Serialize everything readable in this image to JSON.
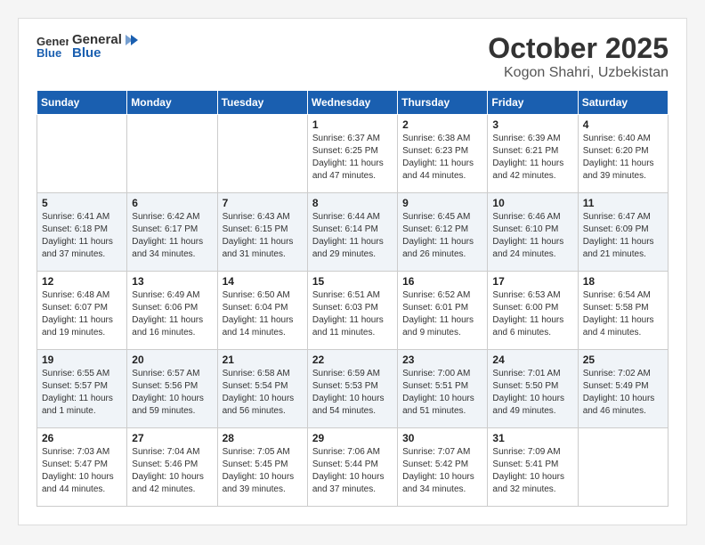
{
  "header": {
    "logo_line1": "General",
    "logo_line2": "Blue",
    "month_year": "October 2025",
    "location": "Kogon Shahri, Uzbekistan"
  },
  "days_of_week": [
    "Sunday",
    "Monday",
    "Tuesday",
    "Wednesday",
    "Thursday",
    "Friday",
    "Saturday"
  ],
  "weeks": [
    {
      "days": [
        {
          "num": "",
          "info": ""
        },
        {
          "num": "",
          "info": ""
        },
        {
          "num": "",
          "info": ""
        },
        {
          "num": "1",
          "info": "Sunrise: 6:37 AM\nSunset: 6:25 PM\nDaylight: 11 hours\nand 47 minutes."
        },
        {
          "num": "2",
          "info": "Sunrise: 6:38 AM\nSunset: 6:23 PM\nDaylight: 11 hours\nand 44 minutes."
        },
        {
          "num": "3",
          "info": "Sunrise: 6:39 AM\nSunset: 6:21 PM\nDaylight: 11 hours\nand 42 minutes."
        },
        {
          "num": "4",
          "info": "Sunrise: 6:40 AM\nSunset: 6:20 PM\nDaylight: 11 hours\nand 39 minutes."
        }
      ]
    },
    {
      "days": [
        {
          "num": "5",
          "info": "Sunrise: 6:41 AM\nSunset: 6:18 PM\nDaylight: 11 hours\nand 37 minutes."
        },
        {
          "num": "6",
          "info": "Sunrise: 6:42 AM\nSunset: 6:17 PM\nDaylight: 11 hours\nand 34 minutes."
        },
        {
          "num": "7",
          "info": "Sunrise: 6:43 AM\nSunset: 6:15 PM\nDaylight: 11 hours\nand 31 minutes."
        },
        {
          "num": "8",
          "info": "Sunrise: 6:44 AM\nSunset: 6:14 PM\nDaylight: 11 hours\nand 29 minutes."
        },
        {
          "num": "9",
          "info": "Sunrise: 6:45 AM\nSunset: 6:12 PM\nDaylight: 11 hours\nand 26 minutes."
        },
        {
          "num": "10",
          "info": "Sunrise: 6:46 AM\nSunset: 6:10 PM\nDaylight: 11 hours\nand 24 minutes."
        },
        {
          "num": "11",
          "info": "Sunrise: 6:47 AM\nSunset: 6:09 PM\nDaylight: 11 hours\nand 21 minutes."
        }
      ]
    },
    {
      "days": [
        {
          "num": "12",
          "info": "Sunrise: 6:48 AM\nSunset: 6:07 PM\nDaylight: 11 hours\nand 19 minutes."
        },
        {
          "num": "13",
          "info": "Sunrise: 6:49 AM\nSunset: 6:06 PM\nDaylight: 11 hours\nand 16 minutes."
        },
        {
          "num": "14",
          "info": "Sunrise: 6:50 AM\nSunset: 6:04 PM\nDaylight: 11 hours\nand 14 minutes."
        },
        {
          "num": "15",
          "info": "Sunrise: 6:51 AM\nSunset: 6:03 PM\nDaylight: 11 hours\nand 11 minutes."
        },
        {
          "num": "16",
          "info": "Sunrise: 6:52 AM\nSunset: 6:01 PM\nDaylight: 11 hours\nand 9 minutes."
        },
        {
          "num": "17",
          "info": "Sunrise: 6:53 AM\nSunset: 6:00 PM\nDaylight: 11 hours\nand 6 minutes."
        },
        {
          "num": "18",
          "info": "Sunrise: 6:54 AM\nSunset: 5:58 PM\nDaylight: 11 hours\nand 4 minutes."
        }
      ]
    },
    {
      "days": [
        {
          "num": "19",
          "info": "Sunrise: 6:55 AM\nSunset: 5:57 PM\nDaylight: 11 hours\nand 1 minute."
        },
        {
          "num": "20",
          "info": "Sunrise: 6:57 AM\nSunset: 5:56 PM\nDaylight: 10 hours\nand 59 minutes."
        },
        {
          "num": "21",
          "info": "Sunrise: 6:58 AM\nSunset: 5:54 PM\nDaylight: 10 hours\nand 56 minutes."
        },
        {
          "num": "22",
          "info": "Sunrise: 6:59 AM\nSunset: 5:53 PM\nDaylight: 10 hours\nand 54 minutes."
        },
        {
          "num": "23",
          "info": "Sunrise: 7:00 AM\nSunset: 5:51 PM\nDaylight: 10 hours\nand 51 minutes."
        },
        {
          "num": "24",
          "info": "Sunrise: 7:01 AM\nSunset: 5:50 PM\nDaylight: 10 hours\nand 49 minutes."
        },
        {
          "num": "25",
          "info": "Sunrise: 7:02 AM\nSunset: 5:49 PM\nDaylight: 10 hours\nand 46 minutes."
        }
      ]
    },
    {
      "days": [
        {
          "num": "26",
          "info": "Sunrise: 7:03 AM\nSunset: 5:47 PM\nDaylight: 10 hours\nand 44 minutes."
        },
        {
          "num": "27",
          "info": "Sunrise: 7:04 AM\nSunset: 5:46 PM\nDaylight: 10 hours\nand 42 minutes."
        },
        {
          "num": "28",
          "info": "Sunrise: 7:05 AM\nSunset: 5:45 PM\nDaylight: 10 hours\nand 39 minutes."
        },
        {
          "num": "29",
          "info": "Sunrise: 7:06 AM\nSunset: 5:44 PM\nDaylight: 10 hours\nand 37 minutes."
        },
        {
          "num": "30",
          "info": "Sunrise: 7:07 AM\nSunset: 5:42 PM\nDaylight: 10 hours\nand 34 minutes."
        },
        {
          "num": "31",
          "info": "Sunrise: 7:09 AM\nSunset: 5:41 PM\nDaylight: 10 hours\nand 32 minutes."
        },
        {
          "num": "",
          "info": ""
        }
      ]
    }
  ]
}
